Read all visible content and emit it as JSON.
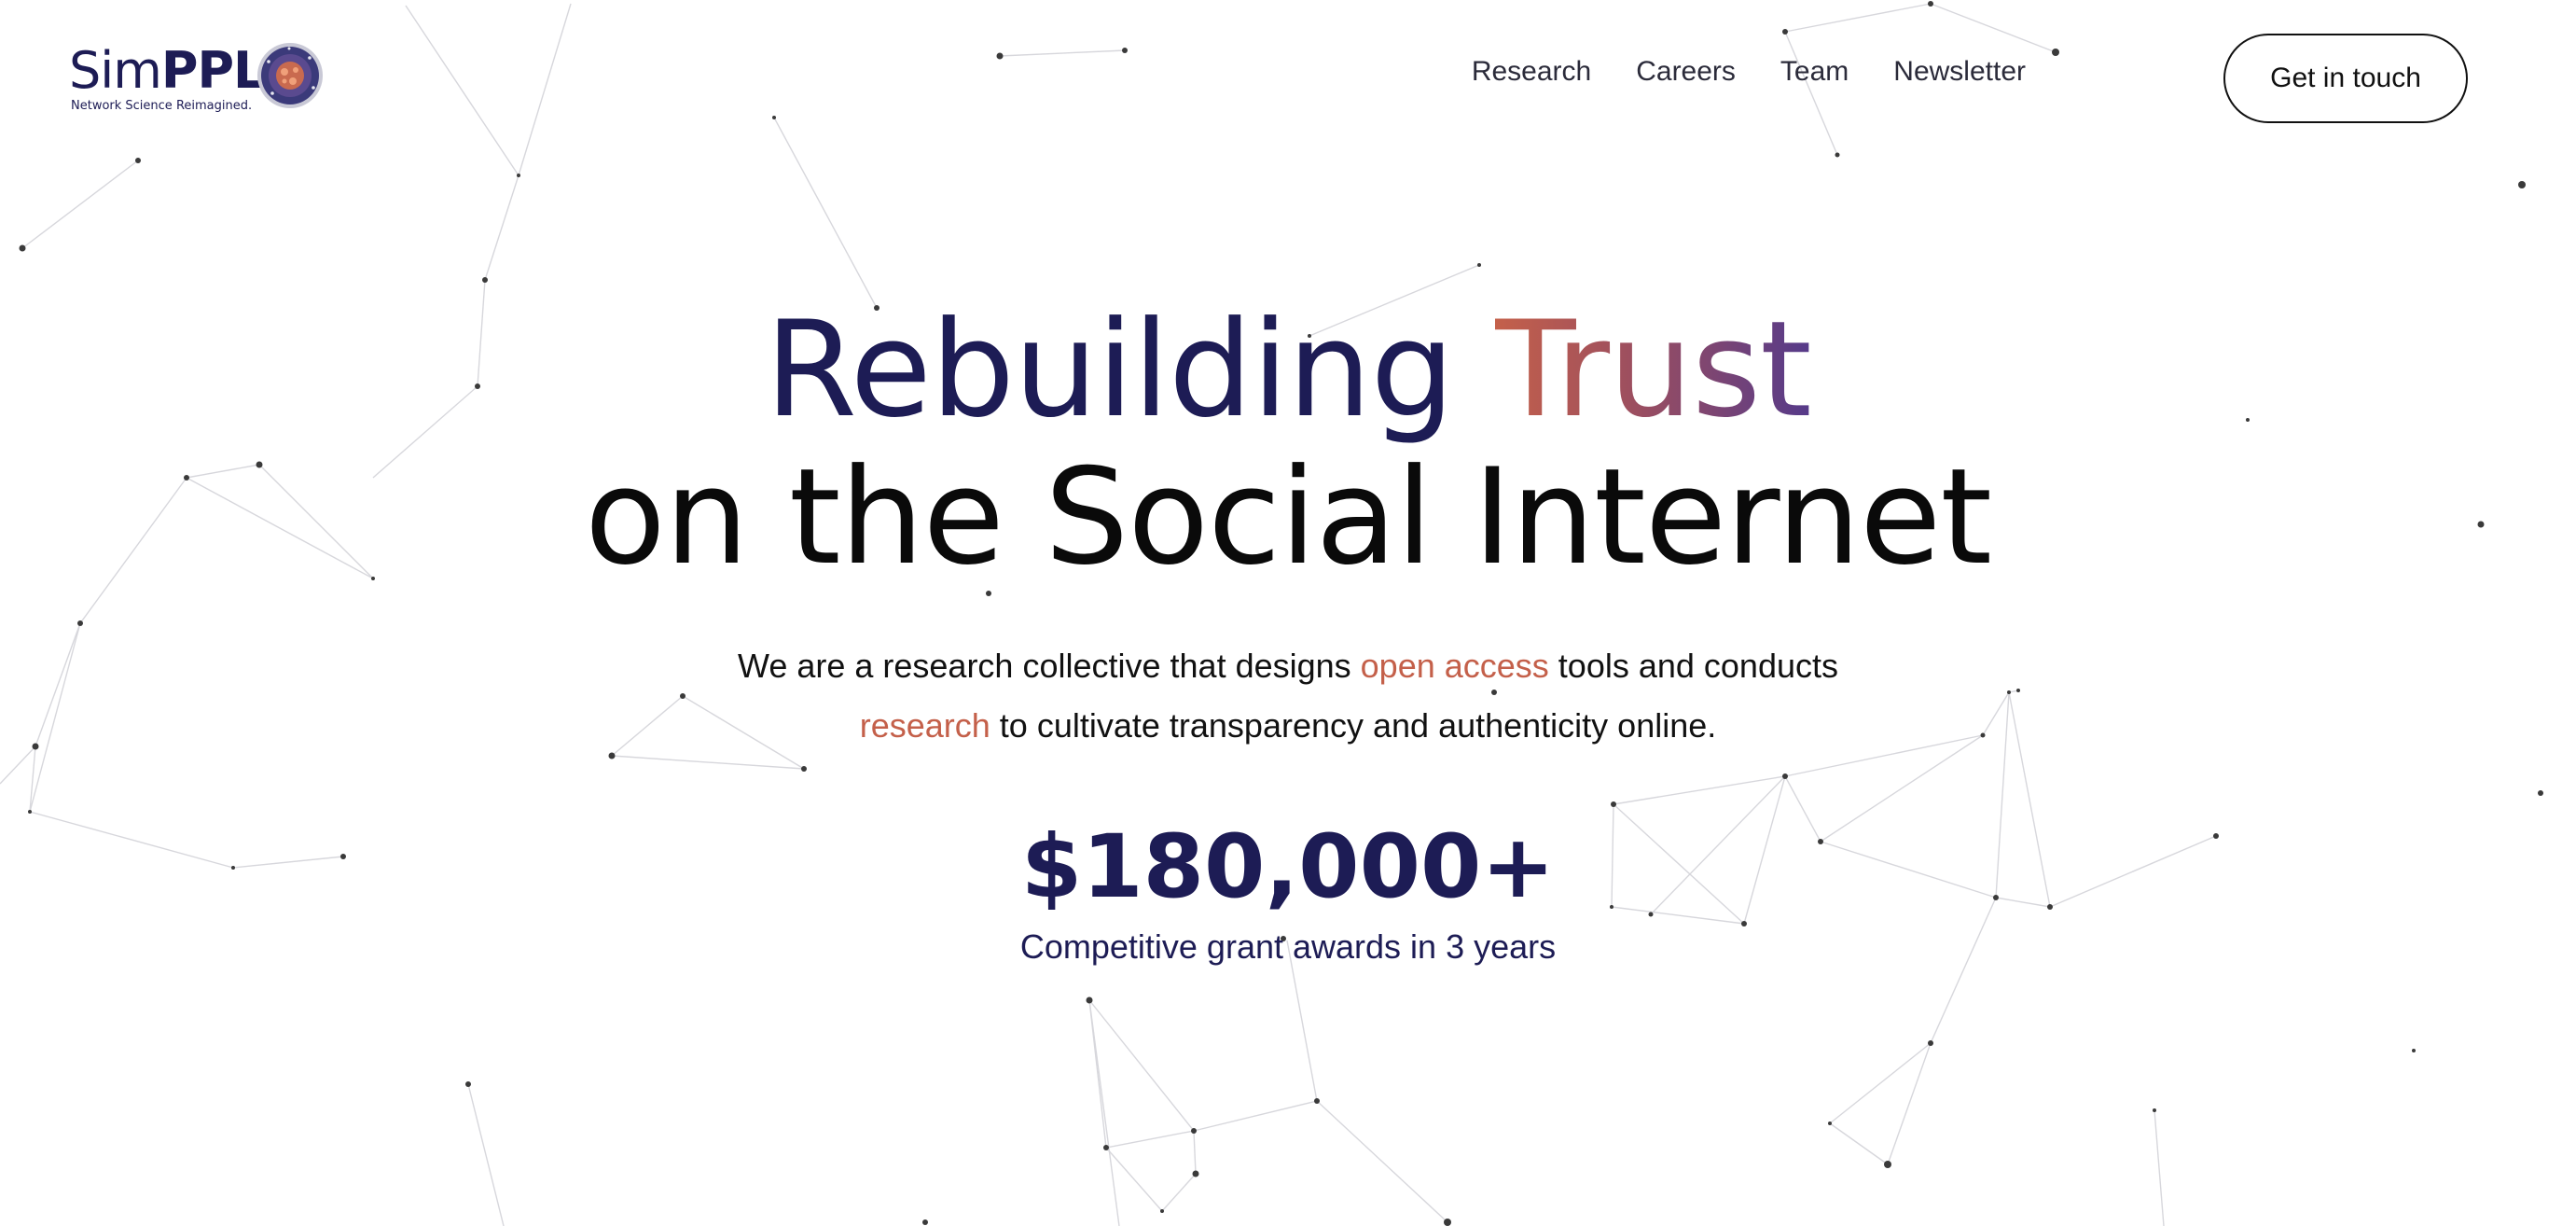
{
  "brand": {
    "name_light": "Sim",
    "name_bold": "PPL",
    "tagline": "Network Science Reimagined."
  },
  "nav": {
    "items": [
      {
        "label": "Research"
      },
      {
        "label": "Careers"
      },
      {
        "label": "Team"
      },
      {
        "label": "Newsletter"
      }
    ],
    "cta_label": "Get in touch"
  },
  "hero": {
    "headline_part1": "Rebuilding ",
    "headline_accent": "Trust",
    "headline_line2": "on the Social Internet",
    "subtitle": {
      "text1": "We are a research collective that designs ",
      "link1": "open access",
      "text2": " tools and conducts ",
      "link2": "research",
      "text3": " to cultivate transparency and authenticity online."
    }
  },
  "stat": {
    "value": "$180,000+",
    "label": "Competitive grant awards in 3 years"
  },
  "colors": {
    "brand_navy": "#1d1c55",
    "accent_orange": "#c4604a",
    "accent_purple": "#553a8a"
  },
  "icons": {
    "logo_emblem": "network-globe-icon"
  }
}
